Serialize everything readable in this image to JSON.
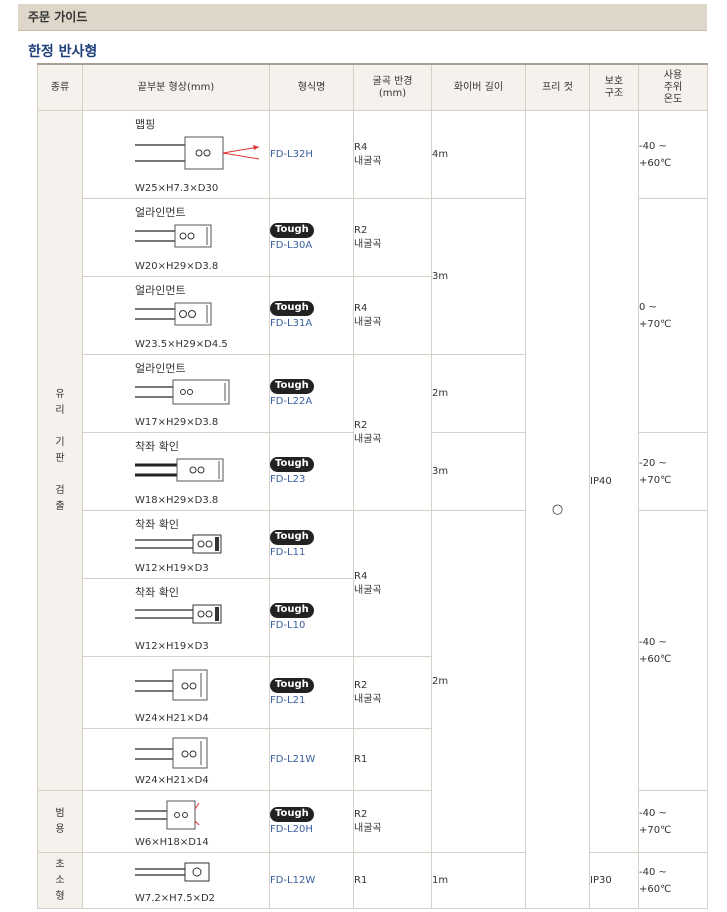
{
  "guide_title": "주문 가이드",
  "section_title": "한정 반사형",
  "headers": {
    "type": "종류",
    "shape": "끝부분 형상(mm)",
    "model": "형식명",
    "bend": "굴곡 반경\n(mm)",
    "length": "화이버 길이",
    "free_cut": "프리 컷",
    "protection": "보호\n구조",
    "temp": "사용\n주위\n온도"
  },
  "groups": [
    {
      "label": "유\n리\n\n기\n판\n\n검\n출"
    },
    {
      "label": "범\n용"
    },
    {
      "label": "초\n소\n형"
    }
  ],
  "rows": [
    {
      "shape_name": "맵핑",
      "dims": "W25×H7.3×D30",
      "tough": false,
      "model": "FD-L32H",
      "icon": "mapping-head-icon"
    },
    {
      "shape_name": "얼라인먼트",
      "dims": "W20×H29×D3.8",
      "tough": true,
      "model": "FD-L30A",
      "icon": "alignment-head-icon"
    },
    {
      "shape_name": "얼라인먼트",
      "dims": "W23.5×H29×D4.5",
      "tough": true,
      "model": "FD-L31A",
      "icon": "alignment-head-icon"
    },
    {
      "shape_name": "얼라인먼트",
      "dims": "W17×H29×D3.8",
      "tough": true,
      "model": "FD-L22A",
      "icon": "alignment-head-icon"
    },
    {
      "shape_name": "착좌 확인",
      "dims": "W18×H29×D3.8",
      "tough": true,
      "model": "FD-L23",
      "icon": "seating-head-icon"
    },
    {
      "shape_name": "착좌 확인",
      "dims": "W12×H19×D3",
      "tough": true,
      "model": "FD-L11",
      "icon": "seating-head-icon"
    },
    {
      "shape_name": "착좌 확인",
      "dims": "W12×H19×D3",
      "tough": true,
      "model": "FD-L10",
      "icon": "seating-head-icon"
    },
    {
      "shape_name": "",
      "dims": "W24×H21×D4",
      "tough": true,
      "model": "FD-L21",
      "icon": "block-head-icon"
    },
    {
      "shape_name": "",
      "dims": "W24×H21×D4",
      "tough": false,
      "model": "FD-L21W",
      "icon": "block-head-icon"
    },
    {
      "shape_name": "",
      "dims": "W6×H18×D14",
      "tough": true,
      "model": "FD-L20H",
      "icon": "general-head-icon"
    },
    {
      "shape_name": "",
      "dims": "W7.2×H7.5×D2",
      "tough": false,
      "model": "FD-L12W",
      "icon": "mini-head-icon"
    }
  ],
  "tough_label": "Tough",
  "bend": [
    {
      "line1": "R4",
      "line2": "내굴곡"
    },
    {
      "line1": "R2",
      "line2": "내굴곡"
    },
    {
      "line1": "R4",
      "line2": "내굴곡"
    },
    {
      "line1": "R2",
      "line2": "내굴곡"
    },
    {
      "line1": "R4",
      "line2": "내굴곡"
    },
    {
      "line1": "R2",
      "line2": "내굴곡"
    },
    {
      "line1": "R1",
      "line2": ""
    },
    {
      "line1": "R2",
      "line2": "내굴곡"
    },
    {
      "line1": "R1",
      "line2": ""
    }
  ],
  "length": [
    "4m",
    "3m",
    "2m",
    "3m",
    "2m",
    "1m"
  ],
  "free_cut_symbol": "○",
  "protection": [
    "IP40",
    "IP30"
  ],
  "temps": [
    {
      "line1": "-40 ~",
      "line2": "+60℃"
    },
    {
      "line1": "0 ~",
      "line2": "+70℃"
    },
    {
      "line1": "-20 ~",
      "line2": "+70℃"
    },
    {
      "line1": "-40 ~",
      "line2": "+60℃"
    },
    {
      "line1": "-40 ~",
      "line2": "+70℃"
    },
    {
      "line1": "-40 ~",
      "line2": "+60℃"
    }
  ]
}
